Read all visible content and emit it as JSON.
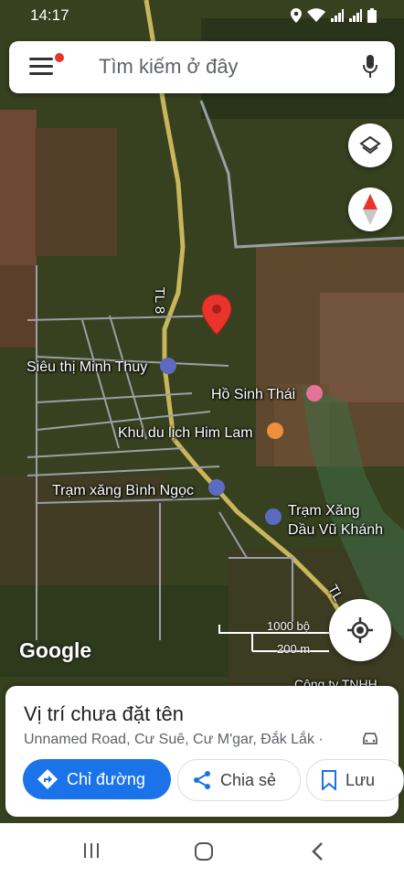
{
  "status_bar": {
    "time": "14:17"
  },
  "search": {
    "placeholder": "Tìm kiếm ở đây"
  },
  "map": {
    "road_label_1": "TL 8",
    "road_label_2": "TL",
    "places": [
      {
        "name": "Siêu thị Minh Thuy"
      },
      {
        "name": "Hồ Sinh Thái"
      },
      {
        "name": "Khu du lịch Him Lam"
      },
      {
        "name": "Trạm xăng Bình Ngọc"
      },
      {
        "name": "Trạm Xăng",
        "name2": "Dầu Vũ Khánh"
      }
    ],
    "partial_label": "Công ty TNHH",
    "scale_imperial": "1000 bộ",
    "scale_metric": "200 m",
    "google_logo": "Google"
  },
  "place_card": {
    "title": "Vị trí chưa đặt tên",
    "address": "Unnamed Road, Cư Suê, Cư M'gar, Đắk Lắk ·",
    "directions_label": "Chỉ đường",
    "share_label": "Chia sẻ",
    "save_label": "Lưu"
  },
  "colors": {
    "accent": "#1a73e8",
    "pin": "#e8342c",
    "poi_shop": "#5c6bc0",
    "poi_food": "#ef8e3c",
    "poi_hotel": "#e57399"
  }
}
